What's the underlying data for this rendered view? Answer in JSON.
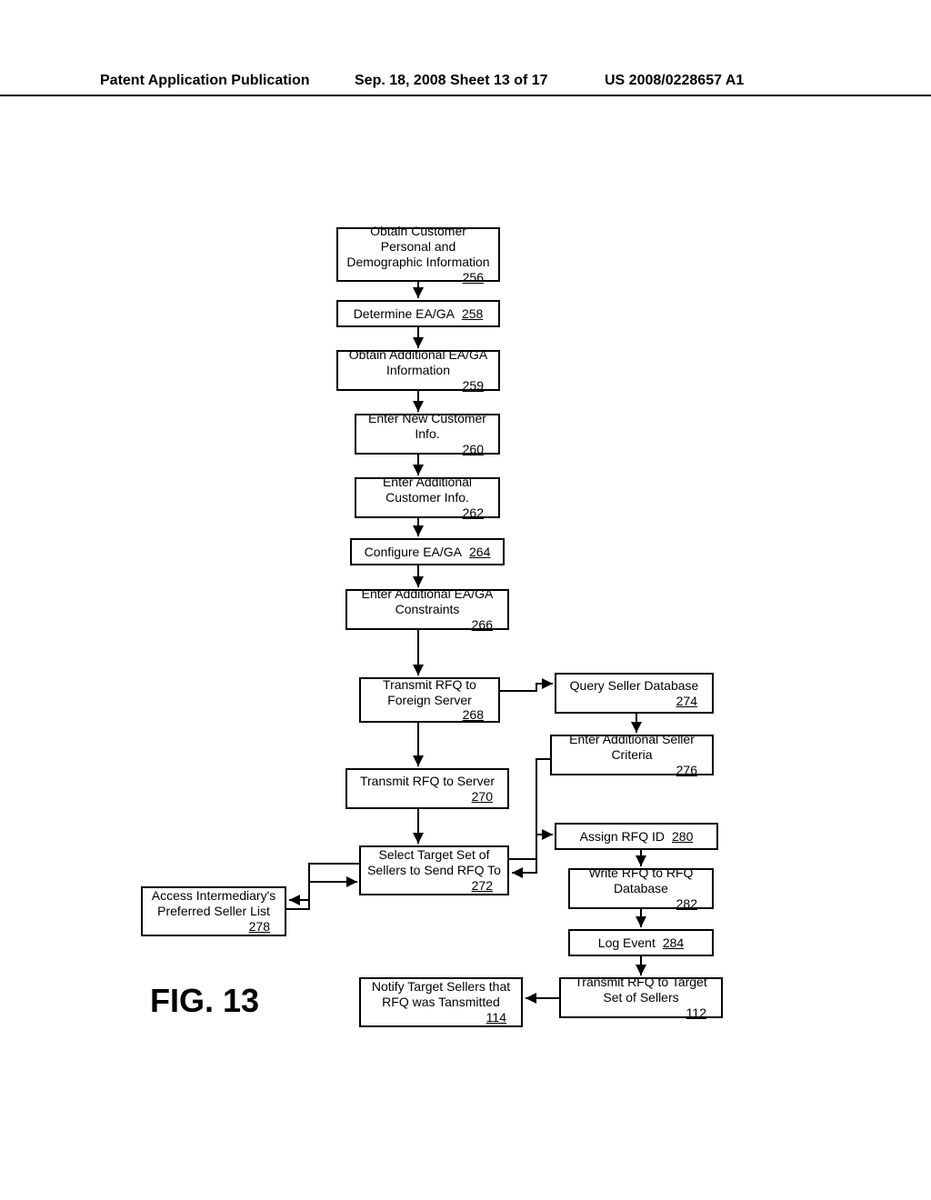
{
  "header": {
    "left": "Patent Application Publication",
    "mid": "Sep. 18, 2008  Sheet 13 of 17",
    "right": "US 2008/0228657 A1"
  },
  "figure_label": "FIG. 13",
  "boxes": {
    "b256": {
      "text": "Obtain Customer Personal and Demographic Information",
      "num": "256"
    },
    "b258": {
      "text": "Determine EA/GA",
      "num": "258"
    },
    "b259": {
      "text": "Obtain Additional EA/GA Information",
      "num": "259"
    },
    "b260": {
      "text": "Enter New Customer Info.",
      "num": "260"
    },
    "b262": {
      "text": "Enter Additional Customer Info.",
      "num": "262"
    },
    "b264": {
      "text": "Configure EA/GA",
      "num": "264"
    },
    "b266": {
      "text": "Enter Additional EA/GA Constraints",
      "num": "266"
    },
    "b268": {
      "text": "Transmit RFQ to Foreign Server",
      "num": "268"
    },
    "b270": {
      "text": "Transmit RFQ to Server",
      "num": "270"
    },
    "b272": {
      "text": "Select Target Set of Sellers to Send RFQ To",
      "num": "272"
    },
    "b274": {
      "text": "Query Seller Database",
      "num": "274"
    },
    "b276": {
      "text": "Enter Additional Seller Criteria",
      "num": "276"
    },
    "b278": {
      "text": "Access Intermediary's Preferred Seller List",
      "num": "278"
    },
    "b280": {
      "text": "Assign RFQ ID",
      "num": "280"
    },
    "b282": {
      "text": "Write RFQ to RFQ Database",
      "num": "282"
    },
    "b284": {
      "text": "Log Event",
      "num": "284"
    },
    "b112": {
      "text": "Transmit RFQ to Target Set of Sellers",
      "num": "112"
    },
    "b114": {
      "text": "Notify Target Sellers that RFQ was Tansmitted",
      "num": "114"
    }
  }
}
